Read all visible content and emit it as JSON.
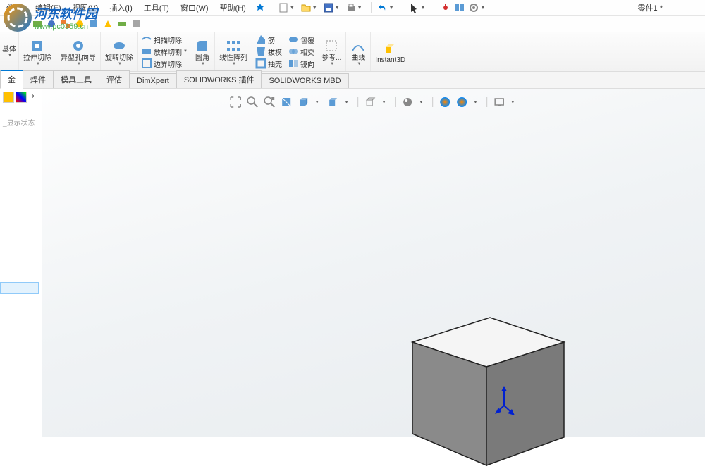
{
  "watermark": {
    "name": "河东软件园",
    "url": "www.pc0359.cn"
  },
  "document_title": "零件1 *",
  "menubar": {
    "file": "件(F)",
    "edit": "编辑(E)",
    "view": "视图(V)",
    "insert": "插入(I)",
    "tools": "工具(T)",
    "window": "窗口(W)",
    "help": "帮助(H)"
  },
  "ribbon": {
    "extrude_base": "基体",
    "extrude_cut": "拉伸切除",
    "hole_wizard": "异型孔向导",
    "revolve_cut": "旋转切除",
    "swept_cut": "扫描切除",
    "loft_cut": "放样切割",
    "boundary_cut": "边界切除",
    "fillet": "圆角",
    "linear_pattern": "线性阵列",
    "rib": "筋",
    "draft": "拔模",
    "shell": "抽壳",
    "wrap": "包覆",
    "intersect": "相交",
    "mirror": "镜向",
    "reference": "参考...",
    "curve": "曲线",
    "instant3d": "Instant3D",
    "sub_base": "/基体"
  },
  "tabs": {
    "sheetmetal": "金",
    "weldments": "焊件",
    "mold_tools": "模具工具",
    "evaluate": "评估",
    "dimxpert": "DimXpert",
    "sw_plugins": "SOLIDWORKS 插件",
    "sw_mbd": "SOLIDWORKS MBD"
  },
  "side_panel": {
    "display_state": "_显示状态"
  }
}
